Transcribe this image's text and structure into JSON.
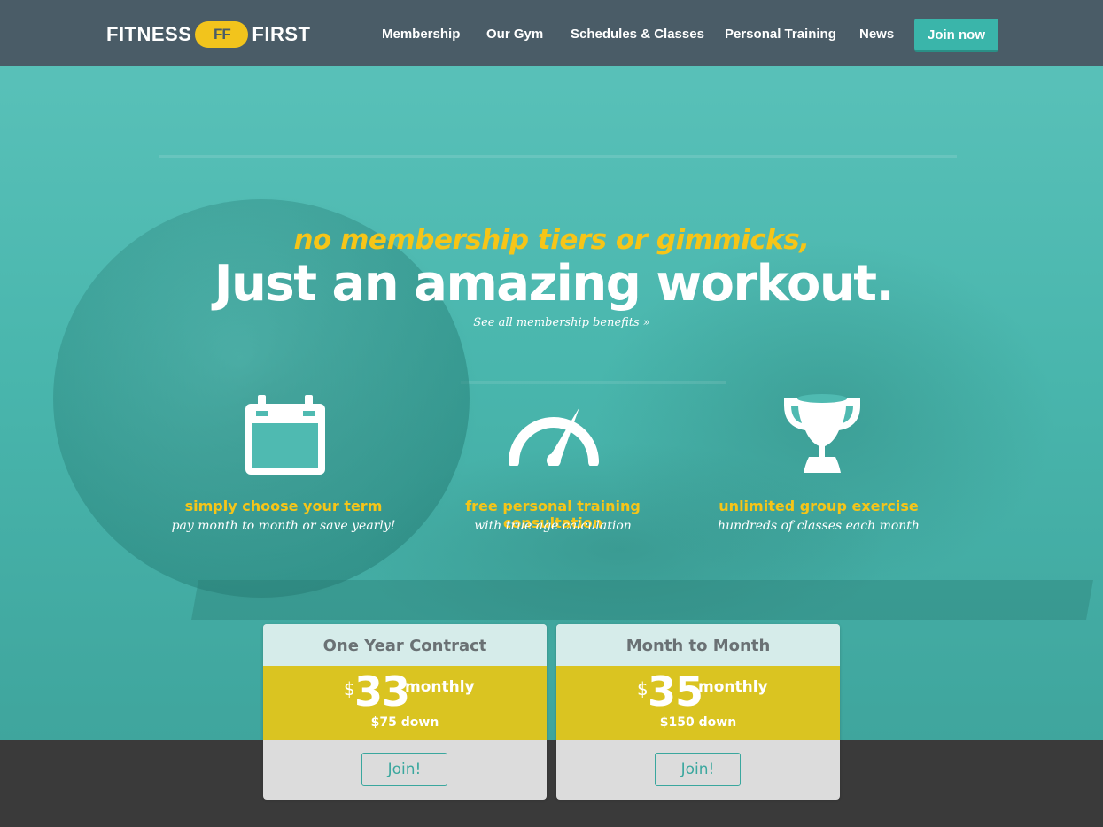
{
  "brand": {
    "logo_text_left": "FITNESS",
    "logo_badge": "FF",
    "logo_text_right": "FIRST"
  },
  "nav": {
    "items": [
      "Membership",
      "Our Gym",
      "Schedules & Classes",
      "Personal Training",
      "News"
    ],
    "cta": "Join now"
  },
  "hero": {
    "tagline": "no membership tiers or gimmicks,",
    "headline": "Just an amazing workout.",
    "benefits_link": "See all membership benefits »"
  },
  "features": [
    {
      "icon": "calendar-icon",
      "title": "simply choose your term",
      "subtitle": "pay month to month or save yearly!"
    },
    {
      "icon": "speedometer-icon",
      "title": "free personal training consultation",
      "subtitle": "with true age calculation"
    },
    {
      "icon": "trophy-icon",
      "title": "unlimited group exercise",
      "subtitle": "hundreds of classes each month"
    }
  ],
  "plans": [
    {
      "name": "One Year Contract",
      "currency": "$",
      "price": "33",
      "period": "monthly",
      "down": "$75 down",
      "cta": "Join!"
    },
    {
      "name": "Month to Month",
      "currency": "$",
      "price": "35",
      "period": "monthly",
      "down": "$150 down",
      "cta": "Join!"
    }
  ],
  "colors": {
    "teal": "#49b6ad",
    "nav": "#4a5c67",
    "yellow": "#f6c518",
    "price_band": "#dac421",
    "footer": "#3a3a3a"
  }
}
